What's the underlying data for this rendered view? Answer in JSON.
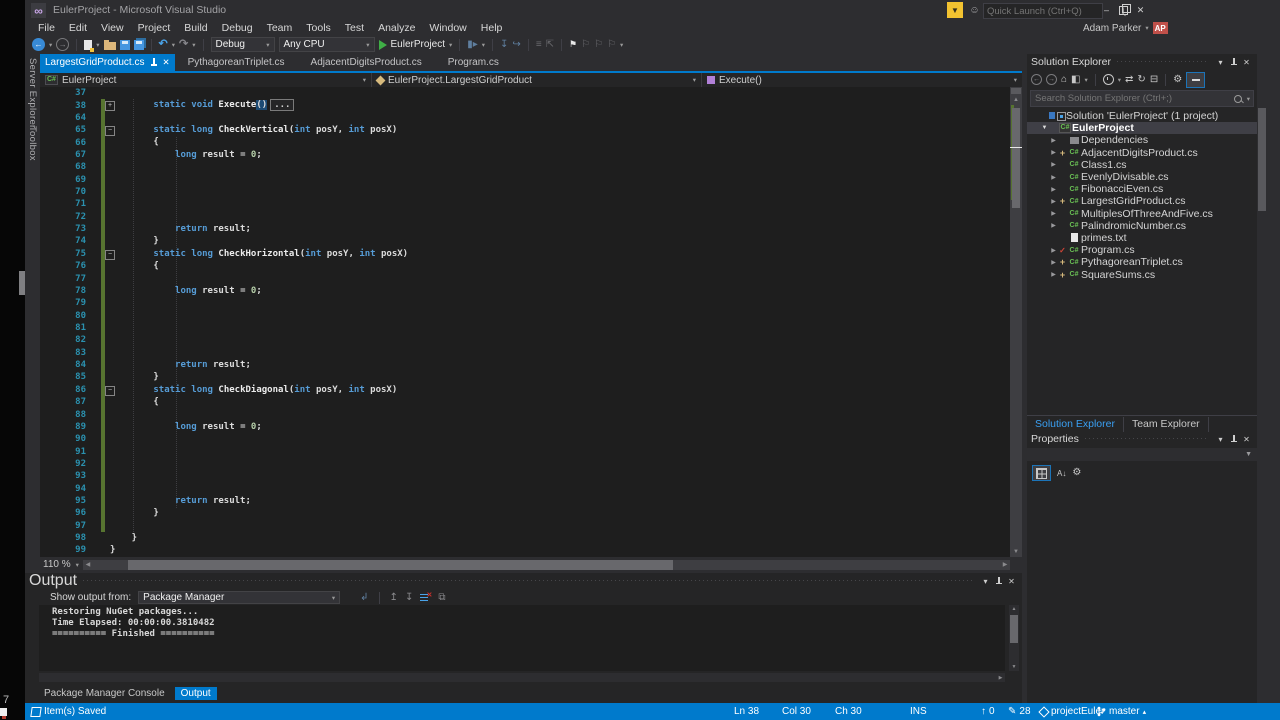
{
  "window": {
    "title": "EulerProject - Microsoft Visual Studio",
    "quick_launch_placeholder": "Quick Launch (Ctrl+Q)",
    "user_name": "Adam Parker",
    "user_initials": "AP"
  },
  "menu_items": [
    "File",
    "Edit",
    "View",
    "Project",
    "Build",
    "Debug",
    "Team",
    "Tools",
    "Test",
    "Analyze",
    "Window",
    "Help"
  ],
  "toolbar": {
    "configuration": "Debug",
    "platform": "Any CPU",
    "startup_project": "EulerProject"
  },
  "side_tabs": [
    "Server Explorer",
    "Toolbox"
  ],
  "editor": {
    "tabs": [
      {
        "label": "LargestGridProduct.cs",
        "active": true
      },
      {
        "label": "PythagoreanTriplet.cs",
        "active": false
      },
      {
        "label": "AdjacentDigitsProduct.cs",
        "active": false
      },
      {
        "label": "Program.cs",
        "active": false
      }
    ],
    "breadcrumb": {
      "project": "EulerProject",
      "type": "EulerProject.LargestGridProduct",
      "member": "Execute()"
    },
    "zoom_level": "110 %",
    "code_lines": [
      {
        "n": 37,
        "chg": false,
        "parts": []
      },
      {
        "n": 38,
        "chg": true,
        "fold": "+",
        "parts": [
          [
            "p",
            "        "
          ],
          [
            "k",
            "static"
          ],
          [
            "p",
            " "
          ],
          [
            "k",
            "void"
          ],
          [
            "p",
            " "
          ],
          [
            "m",
            "Execute"
          ],
          [
            "sel",
            "()"
          ],
          [
            "box",
            "..."
          ]
        ]
      },
      {
        "n": 64,
        "chg": true,
        "parts": []
      },
      {
        "n": 65,
        "chg": true,
        "fold": "-",
        "parts": [
          [
            "p",
            "        "
          ],
          [
            "k",
            "static"
          ],
          [
            "p",
            " "
          ],
          [
            "k",
            "long"
          ],
          [
            "p",
            " "
          ],
          [
            "m",
            "CheckVertical"
          ],
          [
            "p",
            "("
          ],
          [
            "k",
            "int"
          ],
          [
            "p",
            " posY, "
          ],
          [
            "k",
            "int"
          ],
          [
            "p",
            " posX)"
          ]
        ]
      },
      {
        "n": 66,
        "chg": true,
        "parts": [
          [
            "p",
            "        {"
          ]
        ]
      },
      {
        "n": 67,
        "chg": true,
        "parts": [
          [
            "p",
            "            "
          ],
          [
            "k",
            "long"
          ],
          [
            "p",
            " result = "
          ],
          [
            "num",
            "0"
          ],
          [
            "p",
            ";"
          ]
        ]
      },
      {
        "n": 68,
        "chg": true,
        "parts": []
      },
      {
        "n": 69,
        "chg": true,
        "parts": []
      },
      {
        "n": 70,
        "chg": true,
        "parts": []
      },
      {
        "n": 71,
        "chg": true,
        "parts": []
      },
      {
        "n": 72,
        "chg": true,
        "parts": []
      },
      {
        "n": 73,
        "chg": true,
        "parts": [
          [
            "p",
            "            "
          ],
          [
            "k",
            "return"
          ],
          [
            "p",
            " result;"
          ]
        ]
      },
      {
        "n": 74,
        "chg": true,
        "parts": [
          [
            "p",
            "        }"
          ]
        ]
      },
      {
        "n": 75,
        "chg": true,
        "fold": "-",
        "parts": [
          [
            "p",
            "        "
          ],
          [
            "k",
            "static"
          ],
          [
            "p",
            " "
          ],
          [
            "k",
            "long"
          ],
          [
            "p",
            " "
          ],
          [
            "m",
            "CheckHorizontal"
          ],
          [
            "p",
            "("
          ],
          [
            "k",
            "int"
          ],
          [
            "p",
            " posY, "
          ],
          [
            "k",
            "int"
          ],
          [
            "p",
            " posX)"
          ]
        ]
      },
      {
        "n": 76,
        "chg": true,
        "parts": [
          [
            "p",
            "        {"
          ]
        ]
      },
      {
        "n": 77,
        "chg": true,
        "parts": []
      },
      {
        "n": 78,
        "chg": true,
        "parts": [
          [
            "p",
            "            "
          ],
          [
            "k",
            "long"
          ],
          [
            "p",
            " result = "
          ],
          [
            "num",
            "0"
          ],
          [
            "p",
            ";"
          ]
        ]
      },
      {
        "n": 79,
        "chg": true,
        "parts": []
      },
      {
        "n": 80,
        "chg": true,
        "parts": []
      },
      {
        "n": 81,
        "chg": true,
        "parts": []
      },
      {
        "n": 82,
        "chg": true,
        "parts": []
      },
      {
        "n": 83,
        "chg": true,
        "parts": []
      },
      {
        "n": 84,
        "chg": true,
        "parts": [
          [
            "p",
            "            "
          ],
          [
            "k",
            "return"
          ],
          [
            "p",
            " result;"
          ]
        ]
      },
      {
        "n": 85,
        "chg": true,
        "parts": [
          [
            "p",
            "        }"
          ]
        ]
      },
      {
        "n": 86,
        "chg": true,
        "fold": "-",
        "parts": [
          [
            "p",
            "        "
          ],
          [
            "k",
            "static"
          ],
          [
            "p",
            " "
          ],
          [
            "k",
            "long"
          ],
          [
            "p",
            " "
          ],
          [
            "m",
            "CheckDiagonal"
          ],
          [
            "p",
            "("
          ],
          [
            "k",
            "int"
          ],
          [
            "p",
            " posY, "
          ],
          [
            "k",
            "int"
          ],
          [
            "p",
            " posX)"
          ]
        ]
      },
      {
        "n": 87,
        "chg": true,
        "parts": [
          [
            "p",
            "        {"
          ]
        ]
      },
      {
        "n": 88,
        "chg": true,
        "parts": []
      },
      {
        "n": 89,
        "chg": true,
        "parts": [
          [
            "p",
            "            "
          ],
          [
            "k",
            "long"
          ],
          [
            "p",
            " result = "
          ],
          [
            "num",
            "0"
          ],
          [
            "p",
            ";"
          ]
        ]
      },
      {
        "n": 90,
        "chg": true,
        "parts": []
      },
      {
        "n": 91,
        "chg": true,
        "parts": []
      },
      {
        "n": 92,
        "chg": true,
        "parts": []
      },
      {
        "n": 93,
        "chg": true,
        "parts": []
      },
      {
        "n": 94,
        "chg": true,
        "parts": []
      },
      {
        "n": 95,
        "chg": true,
        "parts": [
          [
            "p",
            "            "
          ],
          [
            "k",
            "return"
          ],
          [
            "p",
            " result;"
          ]
        ]
      },
      {
        "n": 96,
        "chg": true,
        "parts": [
          [
            "p",
            "        }"
          ]
        ]
      },
      {
        "n": 97,
        "chg": true,
        "parts": []
      },
      {
        "n": 98,
        "chg": false,
        "parts": [
          [
            "p",
            "    }"
          ]
        ]
      },
      {
        "n": 99,
        "chg": false,
        "parts": [
          [
            "p",
            "}"
          ]
        ]
      }
    ]
  },
  "solution_explorer": {
    "title": "Solution Explorer",
    "search_placeholder": "Search Solution Explorer (Ctrl+;)",
    "tree": [
      {
        "label": "Solution 'EulerProject' (1 project)",
        "icon": "solution",
        "depth": 0
      },
      {
        "label": "EulerProject",
        "icon": "project",
        "depth": 1,
        "arrow": "expanded",
        "selected": true
      },
      {
        "label": "Dependencies",
        "icon": "dependencies",
        "depth": 2,
        "arrow": "collapsed"
      },
      {
        "label": "AdjacentDigitsProduct.cs",
        "icon": "csharp",
        "depth": 2,
        "arrow": "collapsed",
        "badge": "add"
      },
      {
        "label": "Class1.cs",
        "icon": "csharp",
        "depth": 2,
        "arrow": "collapsed"
      },
      {
        "label": "EvenlyDivisable.cs",
        "icon": "csharp",
        "depth": 2,
        "arrow": "collapsed"
      },
      {
        "label": "FibonacciEven.cs",
        "icon": "csharp",
        "depth": 2,
        "arrow": "collapsed"
      },
      {
        "label": "LargestGridProduct.cs",
        "icon": "csharp",
        "depth": 2,
        "arrow": "collapsed",
        "badge": "add"
      },
      {
        "label": "MultiplesOfThreeAndFive.cs",
        "icon": "csharp",
        "depth": 2,
        "arrow": "collapsed"
      },
      {
        "label": "PalindromicNumber.cs",
        "icon": "csharp",
        "depth": 2,
        "arrow": "collapsed"
      },
      {
        "label": "primes.txt",
        "icon": "text",
        "depth": 2
      },
      {
        "label": "Program.cs",
        "icon": "csharp",
        "depth": 2,
        "arrow": "collapsed",
        "badge": "check"
      },
      {
        "label": "PythagoreanTriplet.cs",
        "icon": "csharp",
        "depth": 2,
        "arrow": "collapsed",
        "badge": "add"
      },
      {
        "label": "SquareSums.cs",
        "icon": "csharp",
        "depth": 2,
        "arrow": "collapsed",
        "badge": "add"
      }
    ],
    "bottom_tabs": [
      {
        "label": "Solution Explorer",
        "active": true
      },
      {
        "label": "Team Explorer",
        "active": false
      }
    ]
  },
  "properties_panel": {
    "title": "Properties"
  },
  "output_panel": {
    "title": "Output",
    "show_output_from_label": "Show output from:",
    "source": "Package Manager",
    "lines": [
      "Restoring NuGet packages...",
      "Time Elapsed: 00:00:00.3810482",
      "========== Finished =========="
    ],
    "tool_tabs": [
      {
        "label": "Package Manager Console",
        "active": false
      },
      {
        "label": "Output",
        "active": true
      }
    ]
  },
  "status_bar": {
    "message": "Item(s) Saved",
    "line": "Ln 38",
    "column": "Col 30",
    "character": "Ch 30",
    "mode": "INS",
    "arrow_up_count": "0",
    "pencil_count": "28",
    "repository": "projectEuler",
    "branch": "master"
  },
  "overlay": {
    "corner_label": "7"
  },
  "colors": {
    "accent": "#007acc",
    "keyword": "#569cd6",
    "line_number": "#2b91af",
    "changed_saved": "#577430",
    "user_badge": "#c0504a",
    "quick_launch_flag": "#f2c230",
    "csharp_icon": "#69bf54",
    "method_icon": "#b180d7",
    "add_badge": "#d7ba7d",
    "check_badge": "#d04437"
  }
}
